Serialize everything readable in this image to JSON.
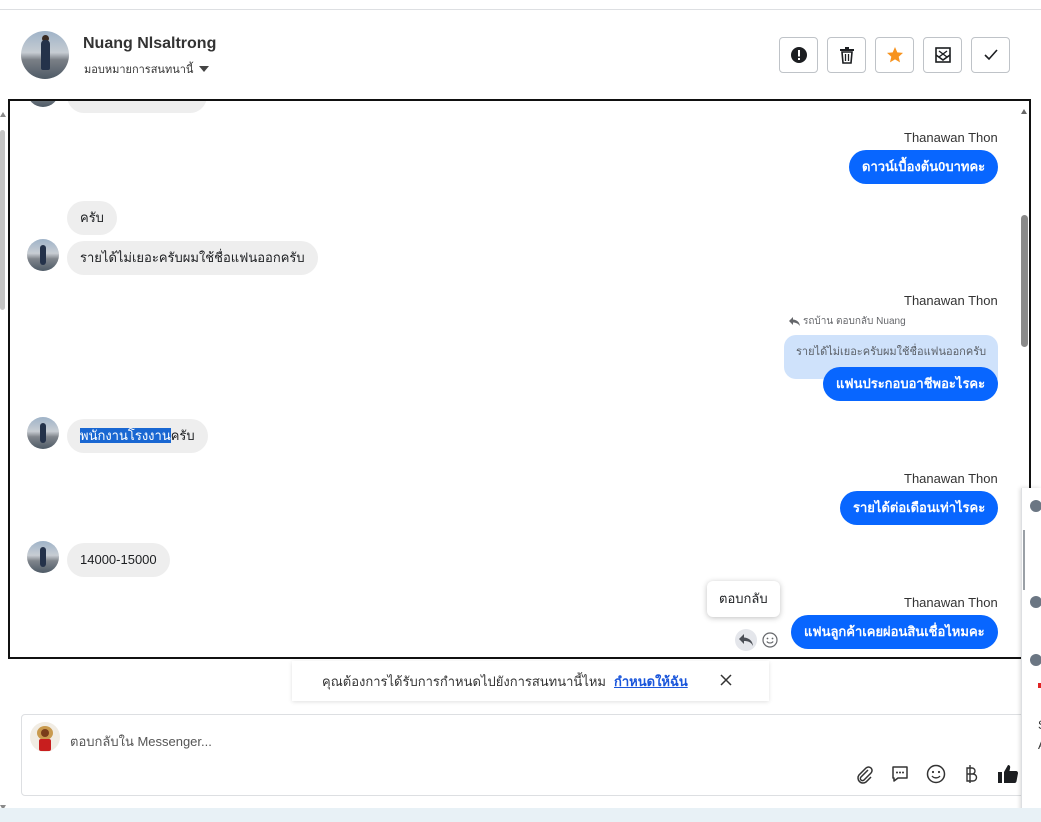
{
  "header": {
    "contact_name": "Nuang Nlsaltrong",
    "assign_label": "มอบหมายการสนทนานี้",
    "actions": [
      "alert-icon",
      "trash-icon",
      "star-icon",
      "mark-unread-icon",
      "check-icon"
    ],
    "star_color": "#f7931e"
  },
  "messages": {
    "in_1": "ครับ",
    "in_2": "รายได้ไม่เยอะครับผมใช้ชื่อแฟนออกครับ",
    "in_3_selected": "พนักงานโรงงาน",
    "in_3_rest": "ครับ",
    "in_4": "14000-15000",
    "sender_name": "Thanawan Thon",
    "out_1": "ดาวน์เบื้องต้น0บาทคะ",
    "reply_note": "รถบ้าน ตอบกลับ Nuang",
    "quoted": "รายได้ไม่เยอะครับผมใช้ชื่อแฟนออกครับ",
    "out_2": "แฟนประกอบอาชีพอะไรคะ",
    "out_3": "รายได้ต่อเดือนเท่าไรคะ",
    "out_4": "แฟนลูกค้าเคยผ่อนสินเชื่อไหมคะ",
    "tooltip": "ตอบกลับ"
  },
  "banner": {
    "text": "คุณต้องการได้รับการกำหนดไปยังการสนทนานี้ไหม",
    "link": "กำหนดให้ฉัน"
  },
  "composer": {
    "placeholder": "ตอบกลับใน Messenger...",
    "tools": [
      "paperclip-icon",
      "chat-bubble-icon",
      "emoji-icon",
      "baht-icon",
      "thumbs-up-icon"
    ]
  },
  "right_panel": {
    "letter_1": "S",
    "letter_2": "A"
  },
  "colors": {
    "accent_blue": "#0866ff",
    "incoming_bubble": "#eeeeee",
    "quote_bubble": "#cfe2fb"
  }
}
